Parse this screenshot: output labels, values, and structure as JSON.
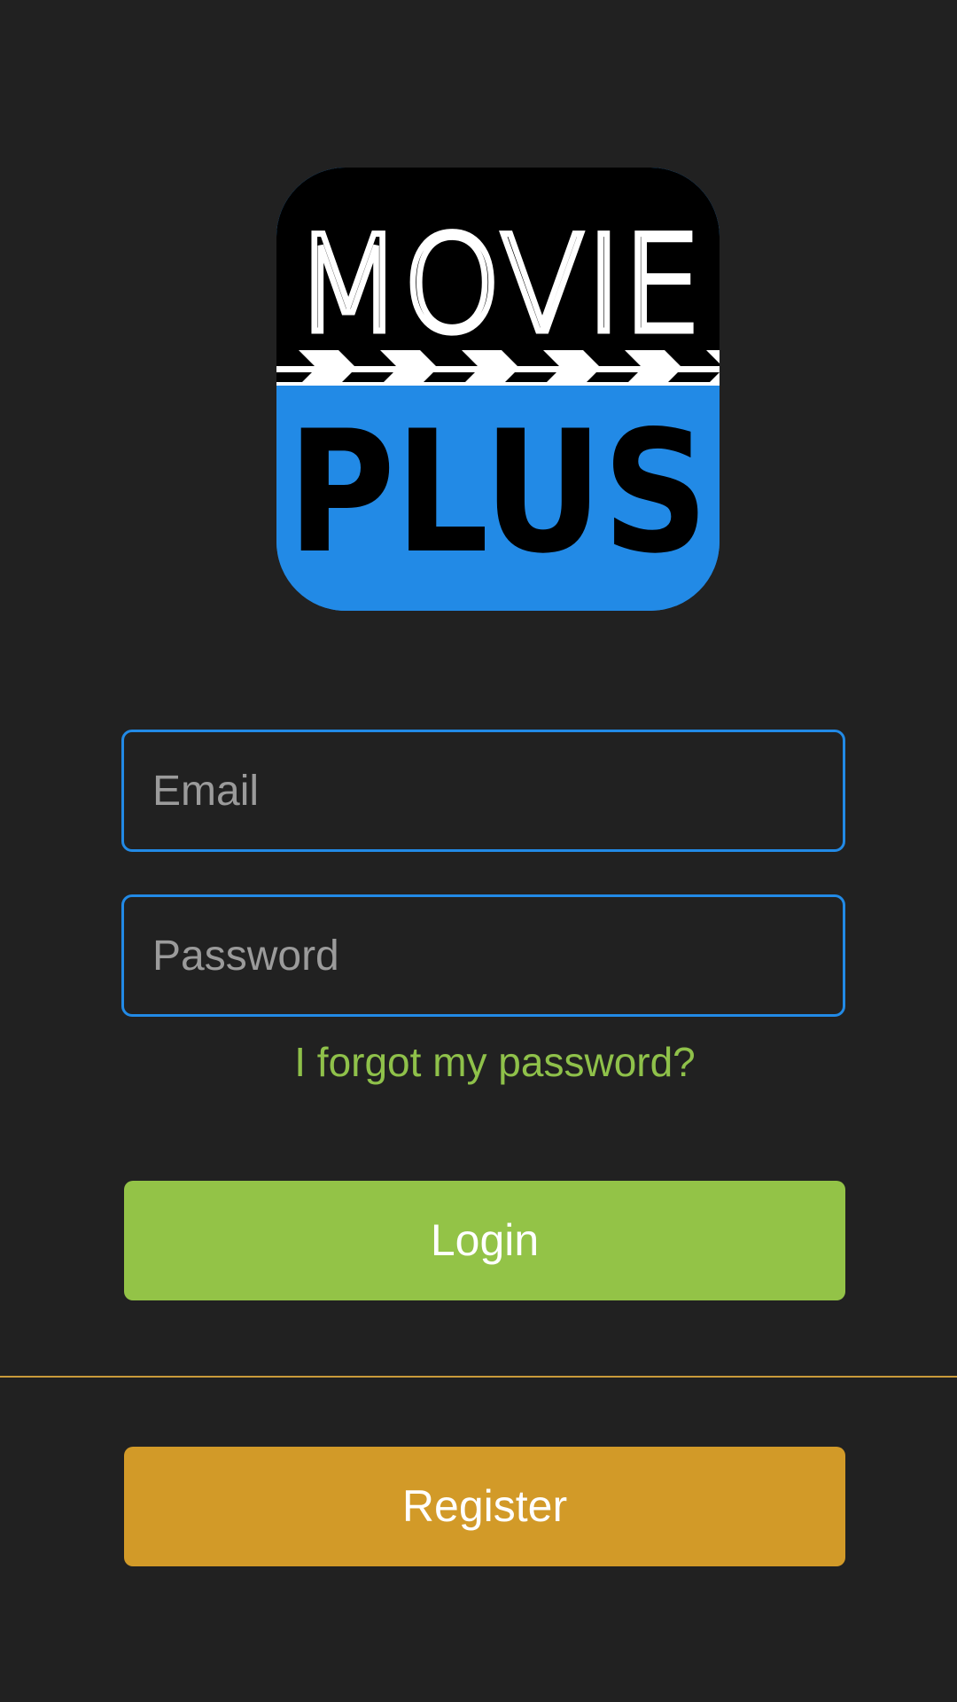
{
  "logo": {
    "line1": "MOVIE",
    "line2": "PLUS",
    "colors": {
      "top": "#000000",
      "bottom": "#228ae6",
      "text_top": "#ffffff",
      "text_bottom": "#000000"
    }
  },
  "form": {
    "email": {
      "placeholder": "Email",
      "value": ""
    },
    "password": {
      "placeholder": "Password",
      "value": ""
    },
    "forgot_password_label": "I forgot my password?",
    "login_label": "Login",
    "register_label": "Register"
  },
  "colors": {
    "background": "#212121",
    "field_border": "#228ae6",
    "link": "#8fc14a",
    "login": "#93c347",
    "register": "#d29a28",
    "divider": "#c99a3a"
  },
  "icons": {
    "logo": "movie-plus-clapperboard-logo"
  }
}
